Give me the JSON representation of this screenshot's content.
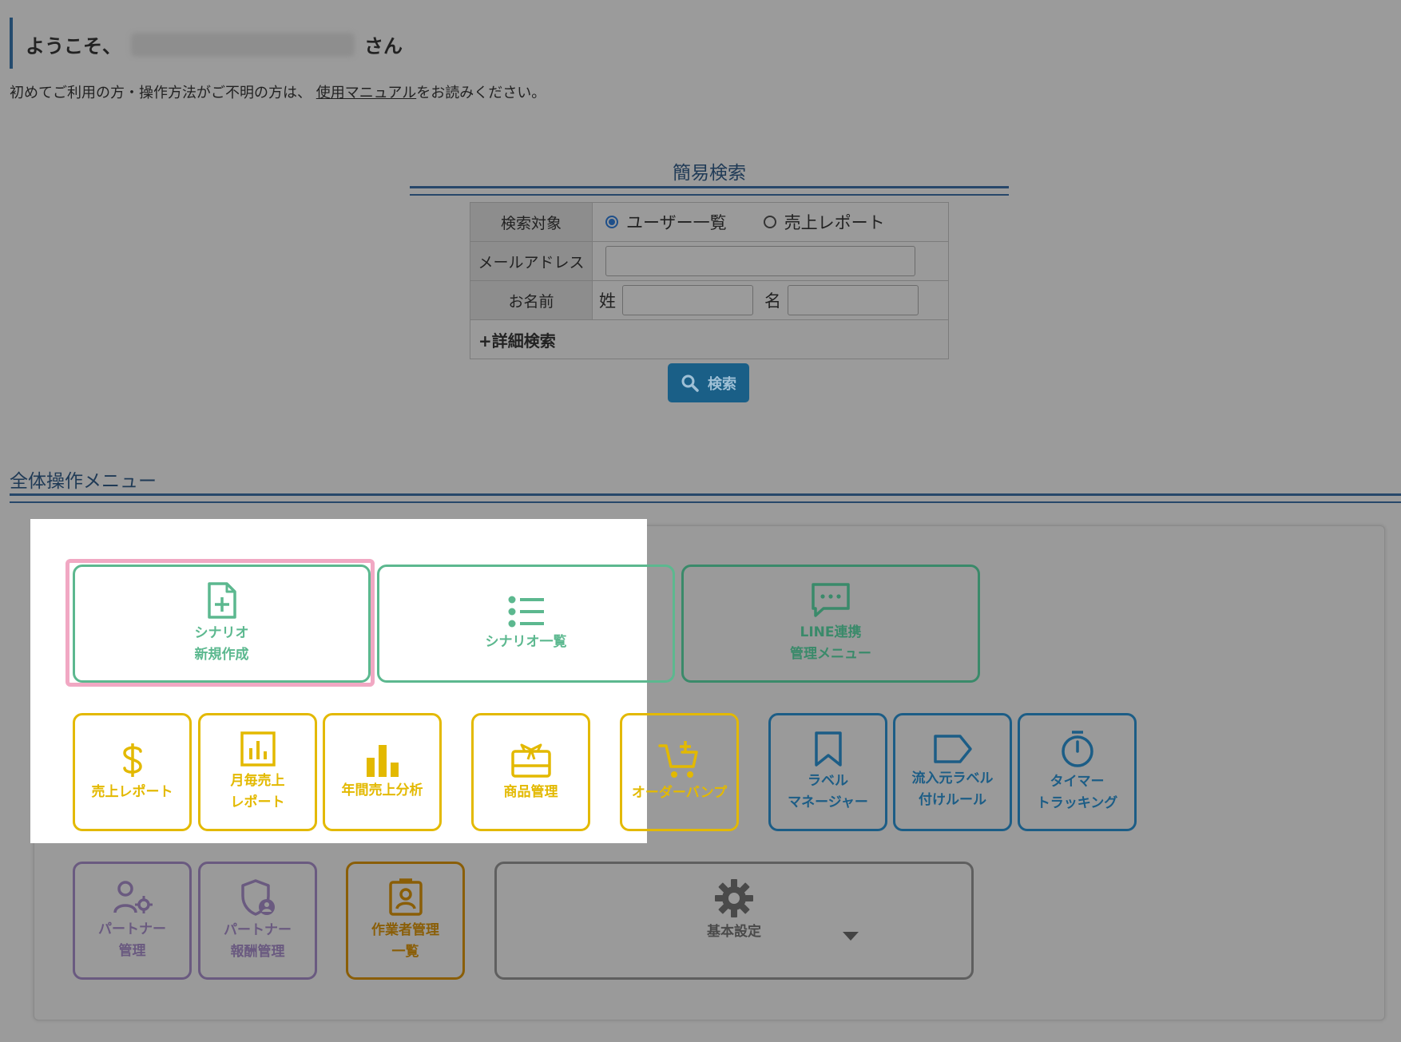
{
  "header": {
    "welcome_prefix": "ようこそ、",
    "welcome_suffix": "さん",
    "intro_before": "初めてご利用の方・操作方法がご不明の方は、",
    "manual_link": "使用マニュアル",
    "intro_after": "をお読みください。"
  },
  "search": {
    "title": "簡易検索",
    "target_label": "検索対象",
    "target_options": [
      "ユーザー一覧",
      "売上レポート"
    ],
    "target_selected": "ユーザー一覧",
    "email_label": "メールアドレス",
    "email_value": "",
    "name_label": "お名前",
    "last_name_label": "姓",
    "last_name_value": "",
    "first_name_label": "名",
    "first_name_value": "",
    "detail_toggle": "+詳細検索",
    "button_label": "検索"
  },
  "menu": {
    "title": "全体操作メニュー",
    "row1": [
      {
        "line1": "シナリオ",
        "line2": "新規作成",
        "icon": "file-plus-icon"
      },
      {
        "line1": "シナリオ一覧",
        "line2": "",
        "icon": "list-icon"
      },
      {
        "line1": "LINE連携",
        "line2": "管理メニュー",
        "icon": "chat-icon"
      }
    ],
    "row2": [
      {
        "line1": "売上レポート",
        "line2": "",
        "icon": "dollar-icon"
      },
      {
        "line1": "月毎売上",
        "line2": "レポート",
        "icon": "bar-chart-icon"
      },
      {
        "line1": "年間売上分析",
        "line2": "",
        "icon": "bars-icon"
      },
      {
        "line1": "商品管理",
        "line2": "",
        "icon": "gift-card-icon"
      },
      {
        "line1": "オーダーバンプ",
        "line2": "",
        "icon": "cart-plus-icon"
      },
      {
        "line1": "ラベル",
        "line2": "マネージャー",
        "icon": "bookmark-icon"
      },
      {
        "line1": "流入元ラベル",
        "line2": "付けルール",
        "icon": "tag-icon"
      },
      {
        "line1": "タイマー",
        "line2": "トラッキング",
        "icon": "timer-icon"
      }
    ],
    "row3": [
      {
        "line1": "パートナー",
        "line2": "管理",
        "icon": "user-gear-icon"
      },
      {
        "line1": "パートナー",
        "line2": "報酬管理",
        "icon": "shield-user-icon"
      },
      {
        "line1": "作業者管理",
        "line2": "一覧",
        "icon": "id-badge-icon"
      },
      {
        "line1": "基本設定",
        "line2": "",
        "icon": "gear-icon"
      }
    ]
  },
  "colors": {
    "green": "#5cb88f",
    "yellow": "#e3b900",
    "blue": "#1c5d86",
    "purple": "#6a5a80",
    "orange": "#8a5e07",
    "highlight_border": "#f1a8c3",
    "search_button": "#1a5f87"
  }
}
